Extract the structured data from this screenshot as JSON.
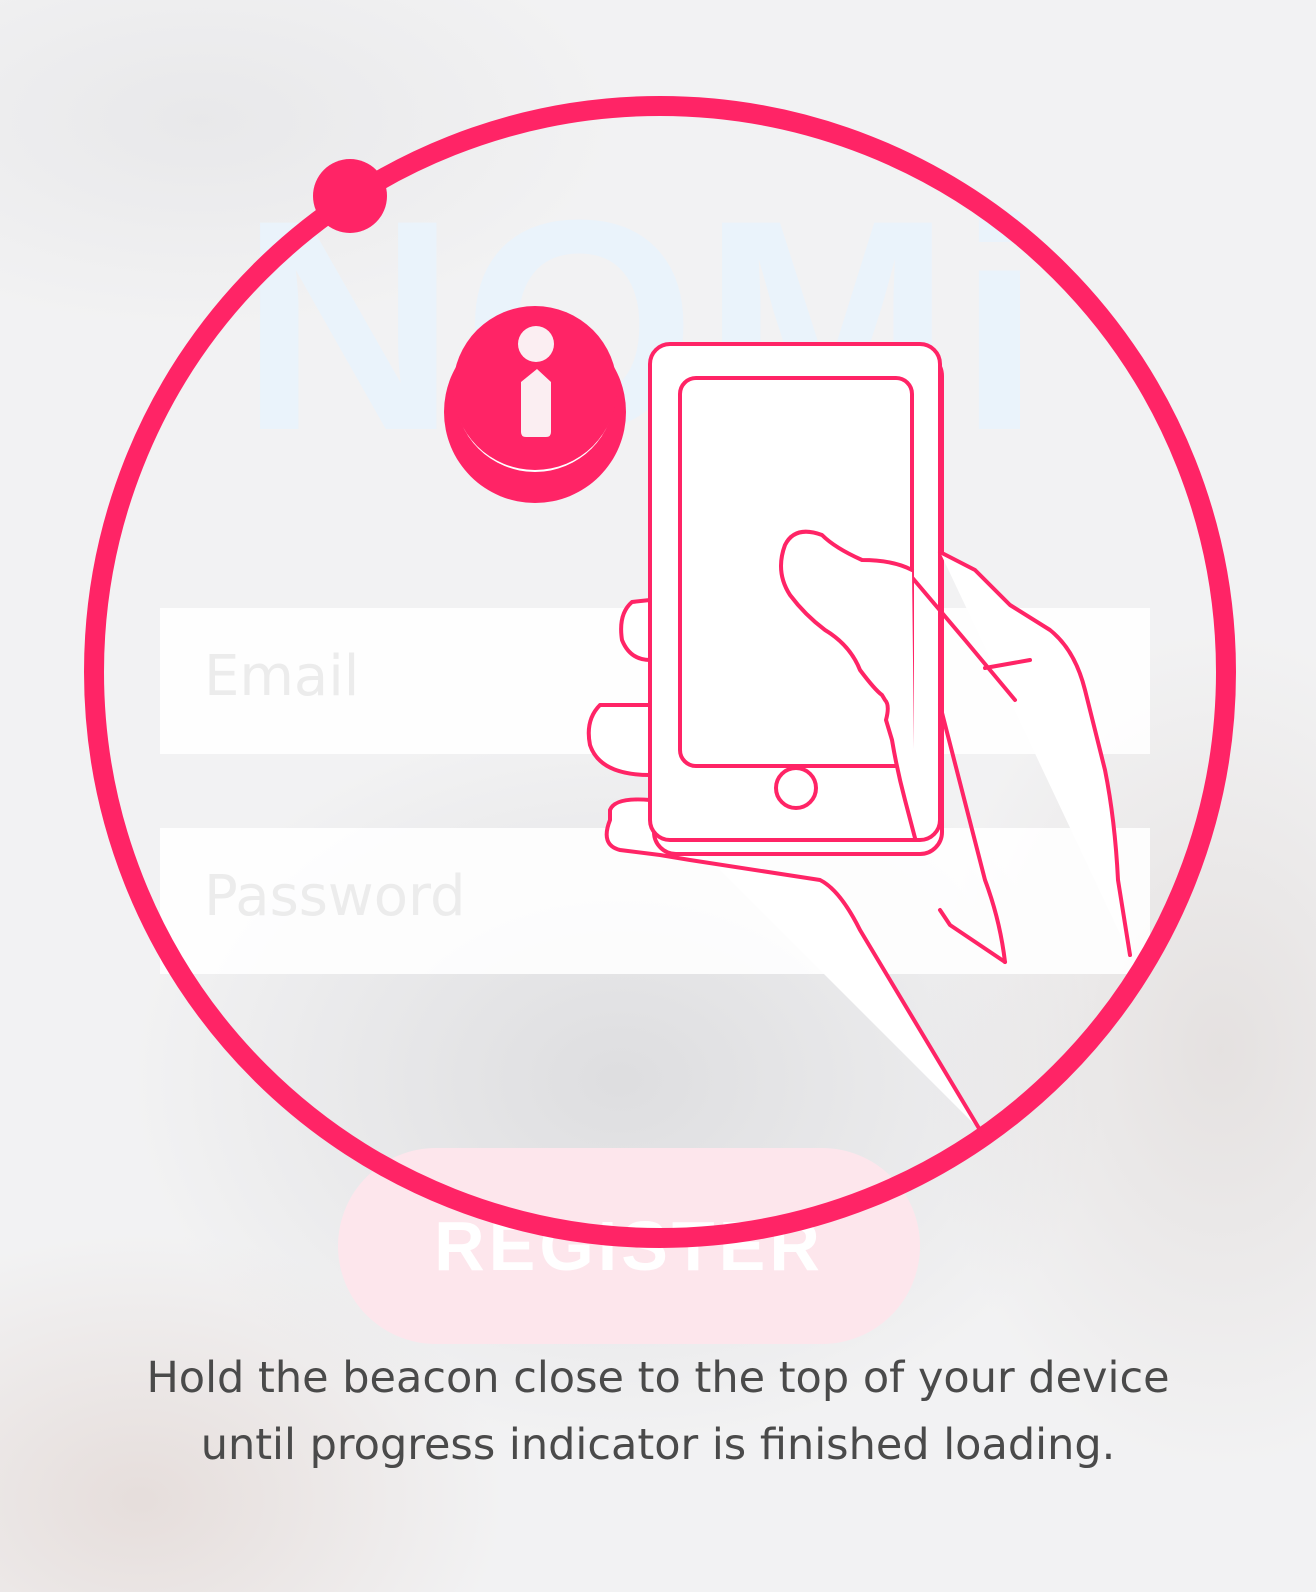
{
  "background": {
    "logo_text": "NOMi"
  },
  "form": {
    "email_placeholder": "Email",
    "password_placeholder": "Password",
    "register_label": "REGISTER"
  },
  "pairing": {
    "progress_ring_color": "#ff2466",
    "info_icon": "info-icon",
    "illustration_icon": "hand-holding-phone-icon"
  },
  "instructions": {
    "line1": "Hold the beacon close to the top of your device",
    "line2": "until progress indicator is finished loading."
  }
}
